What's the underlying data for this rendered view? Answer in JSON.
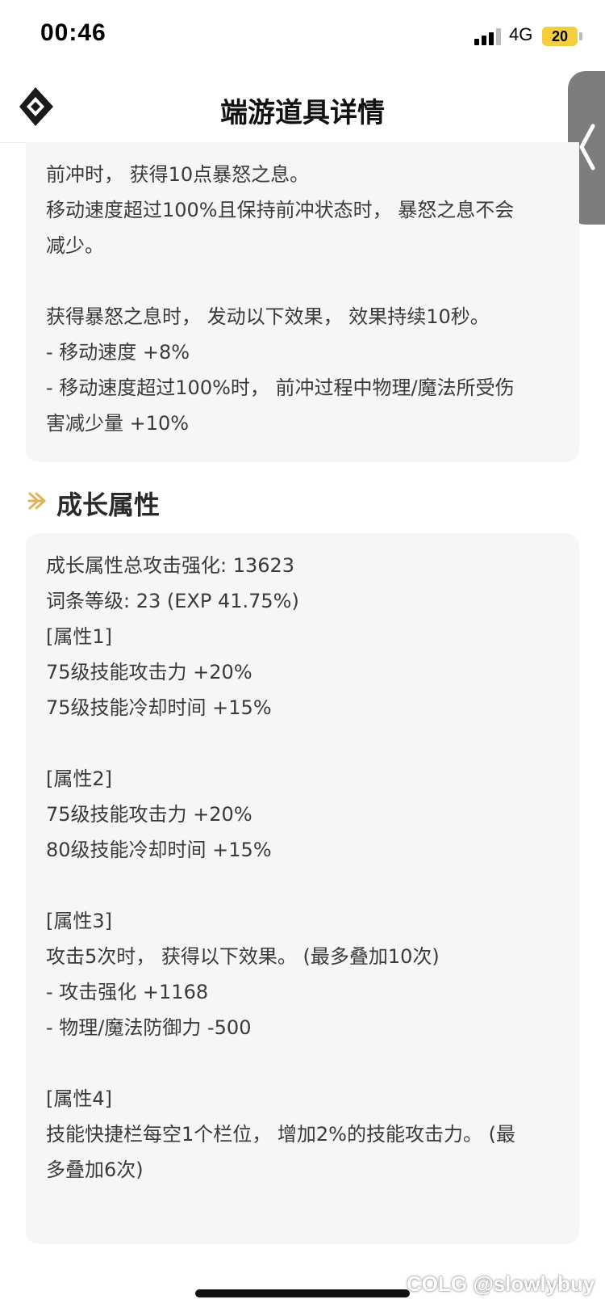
{
  "status_bar": {
    "time": "00:46",
    "network": "4G",
    "battery": "20"
  },
  "header": {
    "title": "端游道具详情",
    "logo_icon": "diamond-logo-icon",
    "back_icon": "chevron-left-icon"
  },
  "effect_card": {
    "lines": [
      "前冲时， 获得10点暴怒之息。",
      "移动速度超过100%且保持前冲状态时， 暴怒之息不会",
      "减少。",
      "",
      "获得暴怒之息时， 发动以下效果， 效果持续10秒。",
      "- 移动速度 +8%",
      "- 移动速度超过100%时， 前冲过程中物理/魔法所受伤",
      "害减少量 +10%"
    ]
  },
  "growth_section": {
    "title": "成长属性",
    "icon": "double-arrow-icon",
    "lines": [
      "成长属性总攻击强化: 13623",
      "词条等级: 23 (EXP 41.75%)",
      "[属性1]",
      "75级技能攻击力 +20%",
      "75级技能冷却时间 +15%",
      "",
      "[属性2]",
      "75级技能攻击力 +20%",
      "80级技能冷却时间 +15%",
      "",
      "[属性3]",
      "攻击5次时， 获得以下效果。 (最多叠加10次)",
      "- 攻击强化 +1168",
      "- 物理/魔法防御力 -500",
      "",
      "[属性4]",
      "技能快捷栏每空1个栏位， 增加2%的技能攻击力。 (最",
      "多叠加6次)"
    ]
  },
  "watermark": "COLG @slowlybuy",
  "colors": {
    "accent": "#e2b25c",
    "card_bg": "#f6f6f6",
    "battery": "#f5cf3b"
  }
}
